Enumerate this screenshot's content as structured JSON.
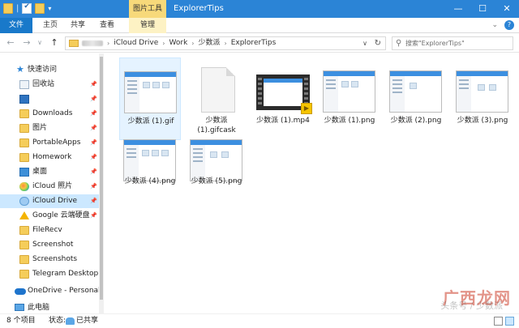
{
  "titlebar": {
    "window_title": "ExplorerTips",
    "context_tab_header": "图片工具",
    "qat_icons": [
      "folder-icon",
      "check-icon",
      "folder-icon"
    ],
    "qat_dropdown": "▾",
    "minimize": "—",
    "maximize": "☐",
    "close": "✕"
  },
  "ribbon": {
    "tabs": [
      {
        "label": "文件"
      },
      {
        "label": "主页"
      },
      {
        "label": "共享"
      },
      {
        "label": "查看"
      },
      {
        "label": "管理"
      }
    ],
    "expand_chevron": "⌄",
    "help": "?"
  },
  "navigation": {
    "back": "←",
    "forward": "→",
    "recent": "∨",
    "up": "↑"
  },
  "address": {
    "crumbs": [
      "iCloud Drive",
      "Work",
      "少数派",
      "ExplorerTips"
    ],
    "separator": "›",
    "dropdown": "∨",
    "refresh": "↻"
  },
  "search": {
    "placeholder": "搜索\"ExplorerTips\"",
    "icon": "⚲"
  },
  "sidebar": {
    "items": [
      {
        "label": "快速访问",
        "icon": "star-icon",
        "pinned": false
      },
      {
        "label": "回收站",
        "icon": "recycle-bin-icon",
        "pinned": true
      },
      {
        "label": "",
        "icon": "app-icon",
        "pinned": true
      },
      {
        "label": "Downloads",
        "icon": "folder-icon",
        "pinned": true
      },
      {
        "label": "图片",
        "icon": "folder-icon",
        "pinned": true
      },
      {
        "label": "PortableApps",
        "icon": "folder-icon",
        "pinned": true
      },
      {
        "label": "Homework",
        "icon": "folder-icon",
        "pinned": true
      },
      {
        "label": "桌面",
        "icon": "desktop-icon",
        "pinned": true
      },
      {
        "label": "iCloud 照片",
        "icon": "photos-icon",
        "pinned": true
      },
      {
        "label": "iCloud Drive",
        "icon": "cloud-icon",
        "pinned": true,
        "selected": true
      },
      {
        "label": "Google 云端硬盘",
        "icon": "google-drive-icon",
        "pinned": true
      },
      {
        "label": "FileRecv",
        "icon": "folder-icon",
        "pinned": false
      },
      {
        "label": "Screenshot",
        "icon": "folder-icon",
        "pinned": false
      },
      {
        "label": "Screenshots",
        "icon": "folder-icon",
        "pinned": false
      },
      {
        "label": "Telegram Desktop",
        "icon": "folder-icon",
        "pinned": false
      },
      {
        "label": "OneDrive - Personal",
        "icon": "onedrive-icon",
        "pinned": false
      },
      {
        "label": "此电脑",
        "icon": "computer-icon",
        "pinned": false
      }
    ],
    "pin_glyph": "📌"
  },
  "files": [
    {
      "name": "少数派 (1).gif",
      "kind": "screenshot",
      "selected": true
    },
    {
      "name": "少数派 (1).gifcask",
      "kind": "document"
    },
    {
      "name": "少数派 (1).mp4",
      "kind": "video"
    },
    {
      "name": "少数派 (1).png",
      "kind": "screenshot"
    },
    {
      "name": "少数派 (2).png",
      "kind": "screenshot"
    },
    {
      "name": "少数派 (3).png",
      "kind": "screenshot"
    },
    {
      "name": "少数派 (4).png",
      "kind": "screenshot"
    },
    {
      "name": "少数派 (5).png",
      "kind": "screenshot"
    }
  ],
  "status": {
    "count": "8 个项目",
    "state_label": "状态:",
    "state_value": "已共享"
  },
  "watermark": {
    "main": "广西龙网",
    "sub": "头条号 / 少数派"
  },
  "colors": {
    "titlebar": "#2b84d6",
    "file_tab": "#1979ca",
    "context_tab": "#f7d97a",
    "selection": "#cce8ff",
    "folder": "#f5cd5a"
  }
}
